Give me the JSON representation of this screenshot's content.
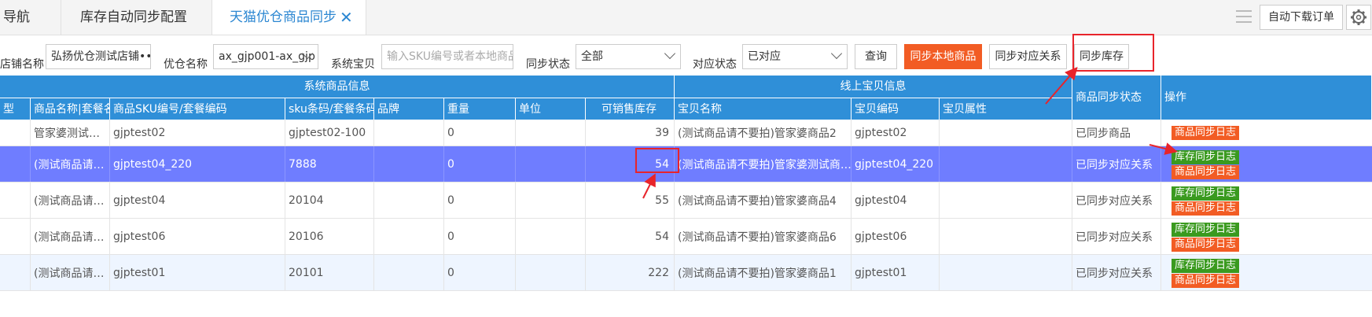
{
  "tabs": [
    {
      "label": "导航"
    },
    {
      "label": "库存自动同步配置"
    },
    {
      "label": "天猫优仓商品同步",
      "active": true
    }
  ],
  "toolbar": {
    "auto_download_label": "自动下载订单"
  },
  "filters": {
    "shop_label": "店铺名称",
    "shop_value": "弘扬优仓测试店铺•••",
    "warehouse_label": "优仓名称",
    "warehouse_value": "ax_gjp001-ax_gjp",
    "sys_item_label": "系统宝贝",
    "sys_item_placeholder": "输入SKU编号或者本地商品",
    "sync_status_label": "同步状态",
    "sync_status_value": "全部",
    "match_status_label": "对应状态",
    "match_status_value": "已对应"
  },
  "buttons": {
    "query": "查询",
    "sync_local": "同步本地商品",
    "sync_mapping": "同步对应关系",
    "sync_stock": "同步库存"
  },
  "table": {
    "group_system": "系统商品信息",
    "group_online": "线上宝贝信息",
    "columns": {
      "type": "型",
      "name": "商品名称|套餐名",
      "sku": "商品SKU编号/套餐编码",
      "barcode": "sku条码/套餐条码",
      "brand": "品牌",
      "weight": "重量",
      "unit": "单位",
      "stock": "可销售库存",
      "item_name": "宝贝名称",
      "item_code": "宝贝编码",
      "item_attr": "宝贝属性",
      "sync_status": "商品同步状态",
      "ops": "操作"
    },
    "rows": [
      {
        "name": "管家婆测试…",
        "sku": "gjptest02",
        "barcode": "gjptest02-100",
        "weight": "0",
        "stock": "39",
        "item_name": "(测试商品请不要拍)管家婆商品2",
        "item_code": "gjptest02",
        "status": "已同步商品",
        "ops": [
          "商品同步日志"
        ]
      },
      {
        "name": "(测试商品请…",
        "sku": "gjptest04_220",
        "barcode": "7888",
        "weight": "0",
        "stock": "54",
        "item_name": "(测试商品请不要拍)管家婆测试商…",
        "item_code": "gjptest04_220",
        "status": "已同步对应关系",
        "ops": [
          "库存同步日志",
          "商品同步日志"
        ]
      },
      {
        "name": "(测试商品请…",
        "sku": "gjptest04",
        "barcode": "20104",
        "weight": "0",
        "stock": "55",
        "item_name": "(测试商品请不要拍)管家婆商品4",
        "item_code": "gjptest04",
        "status": "已同步对应关系",
        "ops": [
          "库存同步日志",
          "商品同步日志"
        ]
      },
      {
        "name": "(测试商品请…",
        "sku": "gjptest06",
        "barcode": "20106",
        "weight": "0",
        "stock": "54",
        "item_name": "(测试商品请不要拍)管家婆商品6",
        "item_code": "gjptest06",
        "status": "已同步对应关系",
        "ops": [
          "库存同步日志",
          "商品同步日志"
        ]
      },
      {
        "name": "(测试商品请…",
        "sku": "gjptest01",
        "barcode": "20101",
        "weight": "0",
        "stock": "222",
        "item_name": "(测试商品请不要拍)管家婆商品1",
        "item_code": "gjptest01",
        "status": "已同步对应关系",
        "ops": [
          "库存同步日志",
          "商品同步日志"
        ]
      }
    ]
  },
  "colors": {
    "accent": "#2f8fd8",
    "orange": "#f25c24",
    "green": "#3a9a1f",
    "selected_row": "#6f7dff",
    "annotation": "#e8242b"
  }
}
